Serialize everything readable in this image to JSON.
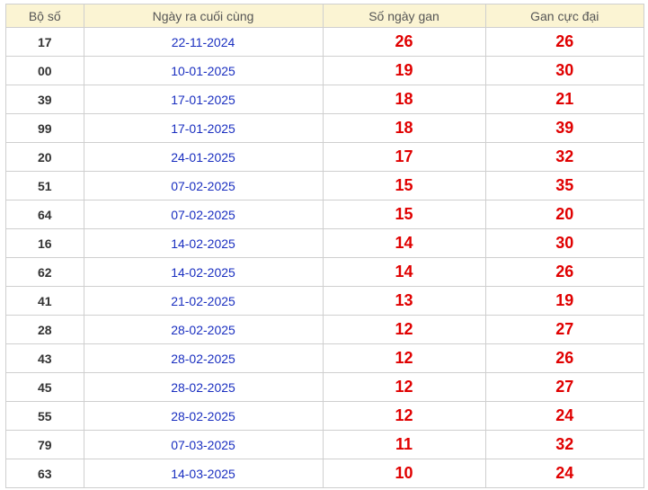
{
  "table": {
    "headers": [
      "Bộ số",
      "Ngày ra cuối cùng",
      "Số ngày gan",
      "Gan cực đại"
    ],
    "rows": [
      {
        "pair": "17",
        "last_date": "22-11-2024",
        "gan_days": "26",
        "max_gan": "26"
      },
      {
        "pair": "00",
        "last_date": "10-01-2025",
        "gan_days": "19",
        "max_gan": "30"
      },
      {
        "pair": "39",
        "last_date": "17-01-2025",
        "gan_days": "18",
        "max_gan": "21"
      },
      {
        "pair": "99",
        "last_date": "17-01-2025",
        "gan_days": "18",
        "max_gan": "39"
      },
      {
        "pair": "20",
        "last_date": "24-01-2025",
        "gan_days": "17",
        "max_gan": "32"
      },
      {
        "pair": "51",
        "last_date": "07-02-2025",
        "gan_days": "15",
        "max_gan": "35"
      },
      {
        "pair": "64",
        "last_date": "07-02-2025",
        "gan_days": "15",
        "max_gan": "20"
      },
      {
        "pair": "16",
        "last_date": "14-02-2025",
        "gan_days": "14",
        "max_gan": "30"
      },
      {
        "pair": "62",
        "last_date": "14-02-2025",
        "gan_days": "14",
        "max_gan": "26"
      },
      {
        "pair": "41",
        "last_date": "21-02-2025",
        "gan_days": "13",
        "max_gan": "19"
      },
      {
        "pair": "28",
        "last_date": "28-02-2025",
        "gan_days": "12",
        "max_gan": "27"
      },
      {
        "pair": "43",
        "last_date": "28-02-2025",
        "gan_days": "12",
        "max_gan": "26"
      },
      {
        "pair": "45",
        "last_date": "28-02-2025",
        "gan_days": "12",
        "max_gan": "27"
      },
      {
        "pair": "55",
        "last_date": "28-02-2025",
        "gan_days": "12",
        "max_gan": "24"
      },
      {
        "pair": "79",
        "last_date": "07-03-2025",
        "gan_days": "11",
        "max_gan": "32"
      },
      {
        "pair": "63",
        "last_date": "14-03-2025",
        "gan_days": "10",
        "max_gan": "24"
      }
    ]
  },
  "colors": {
    "header_background": "#fbf4d3",
    "header_text": "#555555",
    "pair_text": "#333333",
    "date_text": "#1a2fc0",
    "count_text": "#e00000",
    "border": "#cfcfcf"
  }
}
